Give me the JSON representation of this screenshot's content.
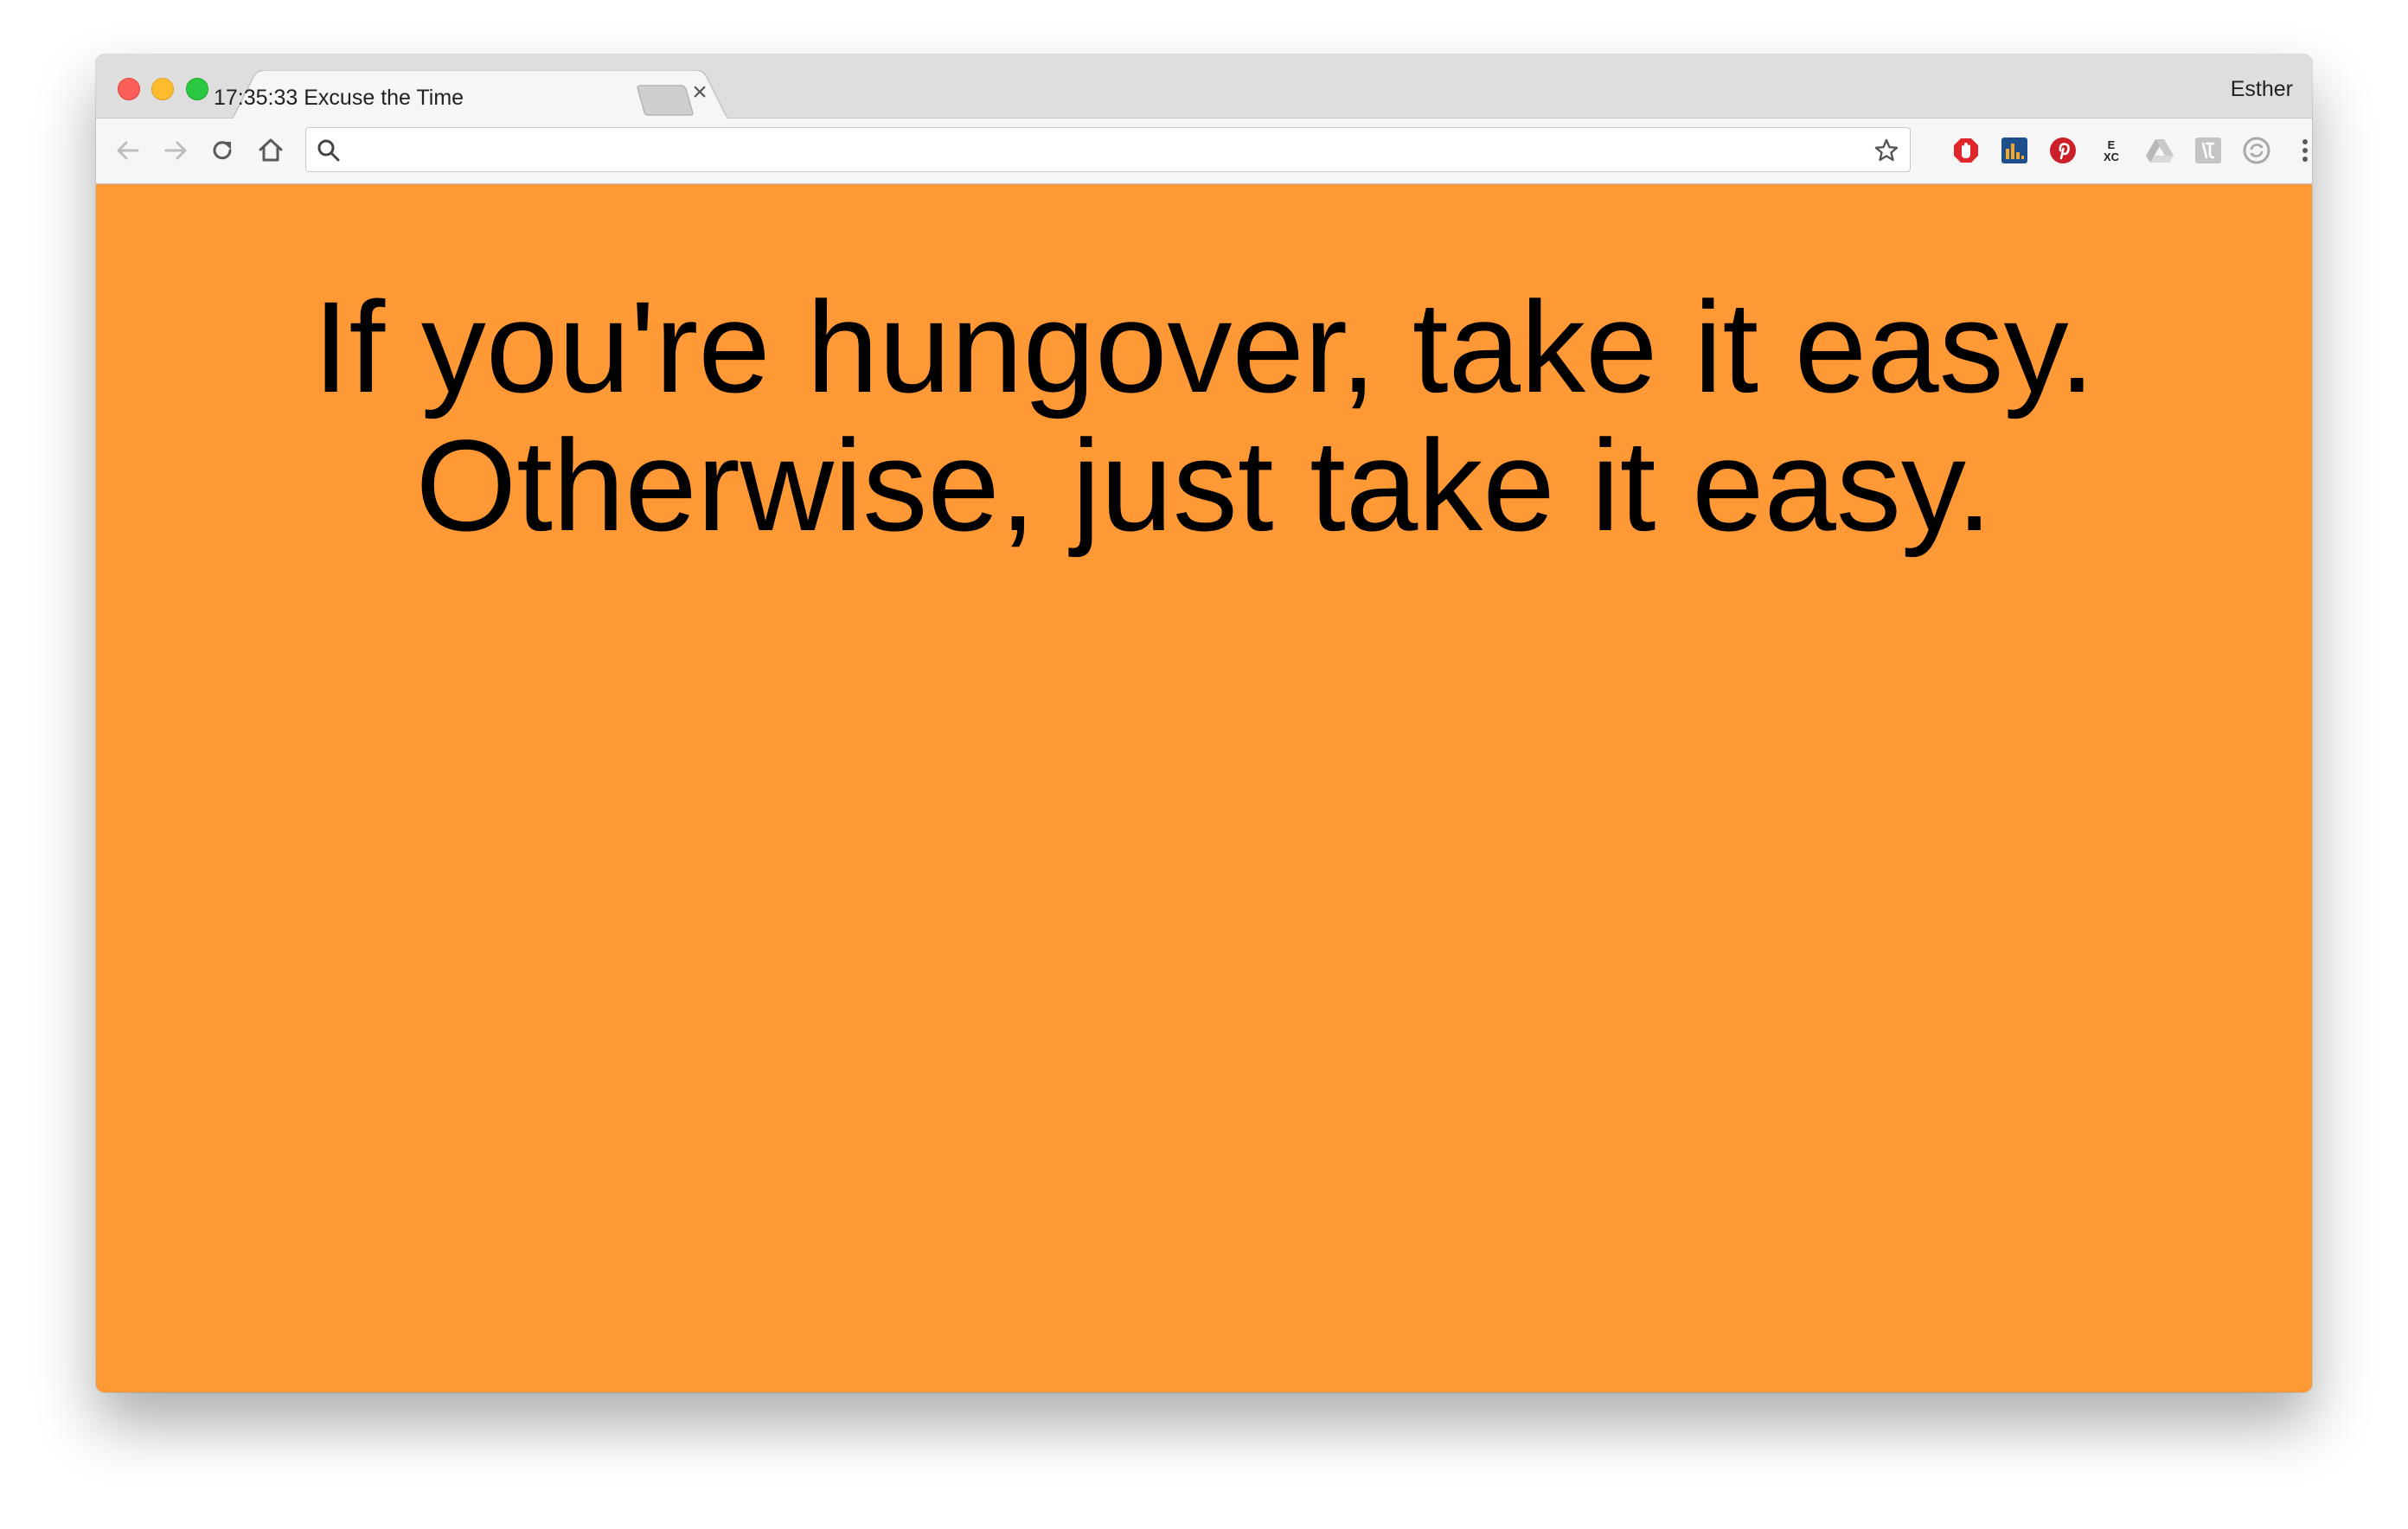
{
  "window": {
    "tab_title": "17:35:33 Excuse the Time",
    "tab_close_glyph": "×",
    "profile_name": "Esther"
  },
  "toolbar": {
    "address_value": "",
    "address_placeholder": "",
    "extensions": [
      "adblock-icon",
      "analytics-icon",
      "pinterest-icon",
      "exc-icon",
      "google-drive-icon",
      "kanji-icon",
      "sync-icon"
    ]
  },
  "page": {
    "background_color": "#ff9935",
    "quote_line_1": "If you're hungover, take it easy.",
    "quote_line_2": "Otherwise, just take it easy."
  },
  "icons": {
    "exc_label_top": "E",
    "exc_label_bottom": "XC"
  }
}
